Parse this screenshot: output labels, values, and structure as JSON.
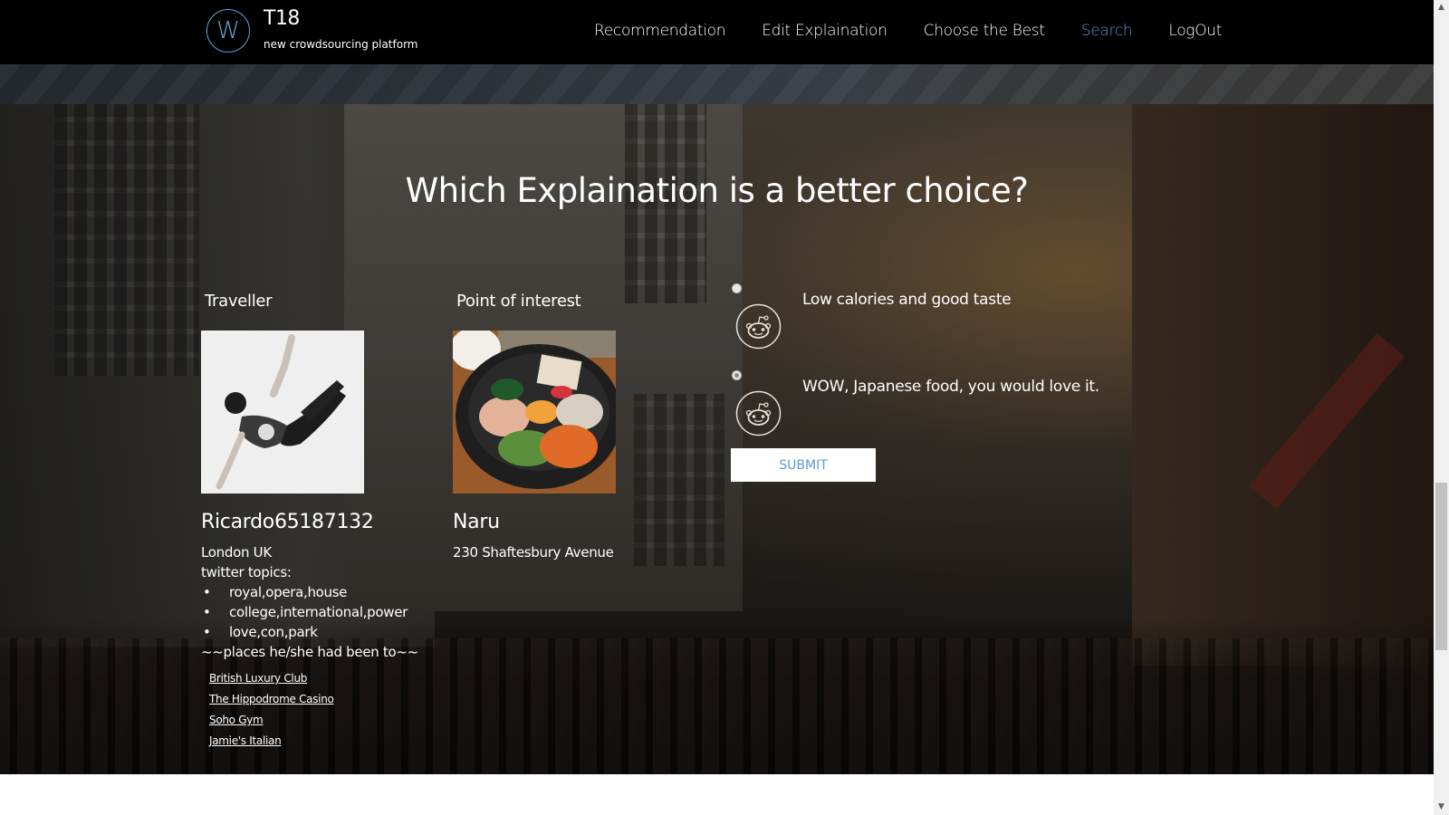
{
  "navbar": {
    "logo_letter": "W",
    "brand_title": "T18",
    "brand_subtitle": "new crowdsourcing platform",
    "links": [
      {
        "label": "Recommendation",
        "active": false
      },
      {
        "label": "Edit Explaination",
        "active": false
      },
      {
        "label": "Choose the Best",
        "active": false
      },
      {
        "label": "Search",
        "active": true
      },
      {
        "label": "LogOut",
        "active": false
      }
    ],
    "active_color": "#5b9bd5"
  },
  "main": {
    "heading": "Which Explaination is a better choice?",
    "traveller": {
      "section_title": "Traveller",
      "photo_alt": "dancer-photo",
      "name": "Ricardo65187132",
      "location": "London UK",
      "topics_label": "twitter topics:",
      "topics": [
        "royal,opera,house",
        "college,international,power",
        "love,con,park"
      ],
      "places_label": "~~places he/she had been to~~",
      "places": [
        "British Luxury Club",
        "The Hippodrome Casino",
        "Soho Gym",
        "Jamie's Italian"
      ]
    },
    "poi": {
      "section_title": "Point of interest",
      "photo_alt": "bibimbap-photo",
      "name": "Naru",
      "address": "230 Shaftesbury Avenue"
    },
    "options": [
      {
        "text": "Low calories and good taste",
        "checked": false,
        "icon": "reddit-alien-icon"
      },
      {
        "text": "WOW, Japanese food, you would love it.",
        "checked": true,
        "icon": "reddit-alien-icon"
      }
    ],
    "submit_label": "SUBMIT"
  },
  "scrollbar": {
    "up_glyph": "▲",
    "down_glyph": "▼",
    "position_fraction": 0.62
  }
}
